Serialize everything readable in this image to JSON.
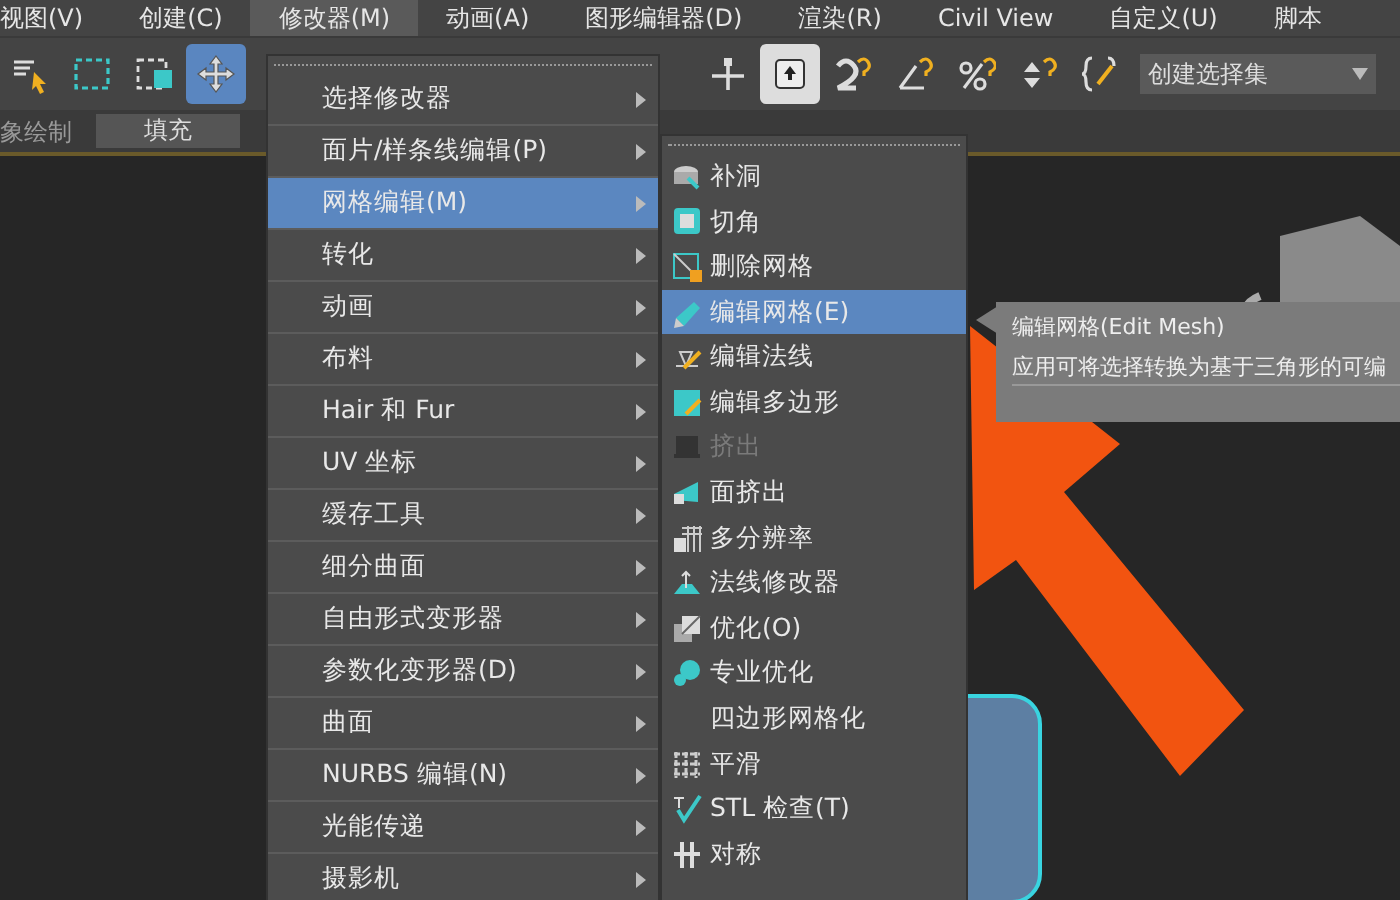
{
  "menubar": [
    {
      "label": "视图(V)",
      "selected": false
    },
    {
      "label": "创建(C)",
      "selected": false
    },
    {
      "label": "修改器(M)",
      "selected": true
    },
    {
      "label": "动画(A)",
      "selected": false
    },
    {
      "label": "图形编辑器(D)",
      "selected": false
    },
    {
      "label": "渲染(R)",
      "selected": false
    },
    {
      "label": "Civil View",
      "selected": false
    },
    {
      "label": "自定义(U)",
      "selected": false
    },
    {
      "label": "脚本",
      "selected": false
    }
  ],
  "toolbar": {
    "tools": [
      {
        "kind": "select-list",
        "selected": false
      },
      {
        "kind": "rect-select",
        "selected": false
      },
      {
        "kind": "window-select",
        "selected": false
      },
      {
        "kind": "move",
        "selected": true
      },
      {
        "kind": "axis",
        "selected": false
      },
      {
        "kind": "pressed",
        "selected": true
      },
      {
        "kind": "snap",
        "selected": false
      },
      {
        "kind": "angle",
        "selected": false
      },
      {
        "kind": "percent",
        "selected": false
      },
      {
        "kind": "spinner",
        "selected": false
      },
      {
        "kind": "sets",
        "selected": false
      }
    ],
    "selection_set": {
      "value": "创建选择集"
    }
  },
  "ribbon": {
    "label": "象绘制",
    "button": "填充"
  },
  "modifiers_menu": {
    "items": [
      {
        "label": "选择修改器",
        "selected": false
      },
      {
        "label": "面片/样条线编辑(P)",
        "selected": false
      },
      {
        "label": "网格编辑(M)",
        "selected": true
      },
      {
        "label": "转化",
        "selected": false
      },
      {
        "label": "动画",
        "selected": false
      },
      {
        "label": "布料",
        "selected": false
      },
      {
        "label": "Hair 和 Fur",
        "selected": false
      },
      {
        "label": "UV 坐标",
        "selected": false
      },
      {
        "label": "缓存工具",
        "selected": false
      },
      {
        "label": "细分曲面",
        "selected": false
      },
      {
        "label": "自由形式变形器",
        "selected": false
      },
      {
        "label": "参数化变形器(D)",
        "selected": false
      },
      {
        "label": "曲面",
        "selected": false
      },
      {
        "label": "NURBS 编辑(N)",
        "selected": false
      },
      {
        "label": "光能传递",
        "selected": false
      },
      {
        "label": "摄影机",
        "selected": false
      }
    ]
  },
  "mesh_edit_submenu": {
    "items": [
      {
        "label": "补洞",
        "selected": false,
        "disabled": false
      },
      {
        "label": "切角",
        "selected": false,
        "disabled": false
      },
      {
        "label": "删除网格",
        "selected": false,
        "disabled": false
      },
      {
        "label": "编辑网格(E)",
        "selected": true,
        "disabled": false
      },
      {
        "label": "编辑法线",
        "selected": false,
        "disabled": false
      },
      {
        "label": "编辑多边形",
        "selected": false,
        "disabled": false
      },
      {
        "label": "挤出",
        "selected": false,
        "disabled": true
      },
      {
        "label": "面挤出",
        "selected": false,
        "disabled": false
      },
      {
        "label": "多分辨率",
        "selected": false,
        "disabled": false
      },
      {
        "label": "法线修改器",
        "selected": false,
        "disabled": false
      },
      {
        "label": "优化(O)",
        "selected": false,
        "disabled": false
      },
      {
        "label": "专业优化",
        "selected": false,
        "disabled": false
      },
      {
        "label": "四边形网格化",
        "selected": false,
        "disabled": false
      },
      {
        "label": "平滑",
        "selected": false,
        "disabled": false
      },
      {
        "label": "STL 检查(T)",
        "selected": false,
        "disabled": false
      },
      {
        "label": "对称",
        "selected": false,
        "disabled": false
      }
    ]
  },
  "tooltip": {
    "title": "编辑网格(Edit Mesh)",
    "description": "应用可将选择转换为基于三角形的可编"
  }
}
